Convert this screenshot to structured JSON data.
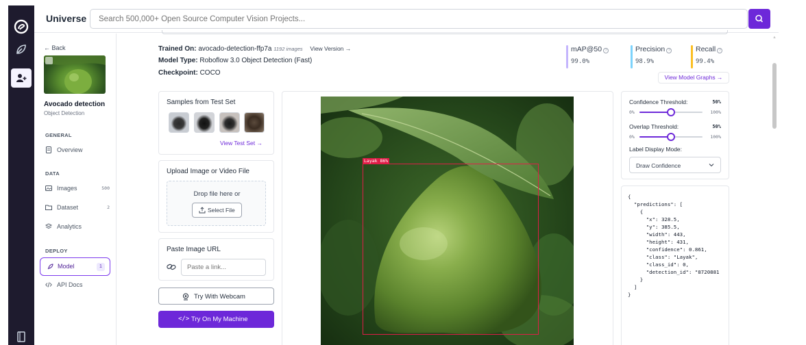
{
  "app": {
    "brand": "Universe",
    "search_placeholder": "Search 500,000+ Open Source Computer Vision Projects..."
  },
  "sidebar": {
    "back_label": "Back",
    "project_name": "Avocado detection",
    "project_type": "Object Detection",
    "sections": {
      "general": "GENERAL",
      "data": "DATA",
      "deploy": "DEPLOY"
    },
    "items": {
      "overview": {
        "label": "Overview"
      },
      "images": {
        "label": "Images",
        "count": "500"
      },
      "dataset": {
        "label": "Dataset",
        "count": "2"
      },
      "analytics": {
        "label": "Analytics"
      },
      "model": {
        "label": "Model",
        "badge": "1"
      },
      "api_docs": {
        "label": "API Docs"
      }
    }
  },
  "model_info": {
    "trained_on_label": "Trained On:",
    "trained_on_value": "avocado-detection-ffp7a",
    "image_count": "1192 images",
    "view_version": "View Version →",
    "model_type_label": "Model Type:",
    "model_type_value": "Roboflow 3.0 Object Detection (Fast)",
    "checkpoint_label": "Checkpoint:",
    "checkpoint_value": "COCO"
  },
  "metrics": {
    "map": {
      "label": "mAP@50",
      "value": "99.0%",
      "color": "#c4b5fd"
    },
    "precision": {
      "label": "Precision",
      "value": "98.9%",
      "color": "#7dd3fc"
    },
    "recall": {
      "label": "Recall",
      "value": "99.4%",
      "color": "#fbbf24"
    },
    "view_graphs": "View Model Graphs →"
  },
  "samples": {
    "title": "Samples from Test Set",
    "view_test_set": "View Test Set →"
  },
  "upload": {
    "title": "Upload Image or Video File",
    "drop_text": "Drop file here or",
    "select_file": "Select File"
  },
  "paste_url": {
    "title": "Paste Image URL",
    "placeholder": "Paste a link..."
  },
  "actions": {
    "webcam": "Try With Webcam",
    "machine": "Try On My Machine"
  },
  "detection": {
    "label": "Layak 86%"
  },
  "settings": {
    "confidence_label": "Confidence Threshold:",
    "confidence_value": "50%",
    "confidence_fraction": 0.5,
    "overlap_label": "Overlap Threshold:",
    "overlap_value": "50%",
    "overlap_fraction": 0.5,
    "slider_min": "0%",
    "slider_max": "100%",
    "label_mode_label": "Label Display Mode:",
    "label_mode_value": "Draw Confidence"
  },
  "json_output": "{\n  \"predictions\": [\n    {\n      \"x\": 328.5,\n      \"y\": 385.5,\n      \"width\": 443,\n      \"height\": 431,\n      \"confidence\": 0.861,\n      \"class\": \"Layak\",\n      \"class_id\": 0,\n      \"detection_id\": \"8720881\n    }\n  ]\n}",
  "colors": {
    "accent": "#6d28d9",
    "detection": "#e11d48"
  }
}
